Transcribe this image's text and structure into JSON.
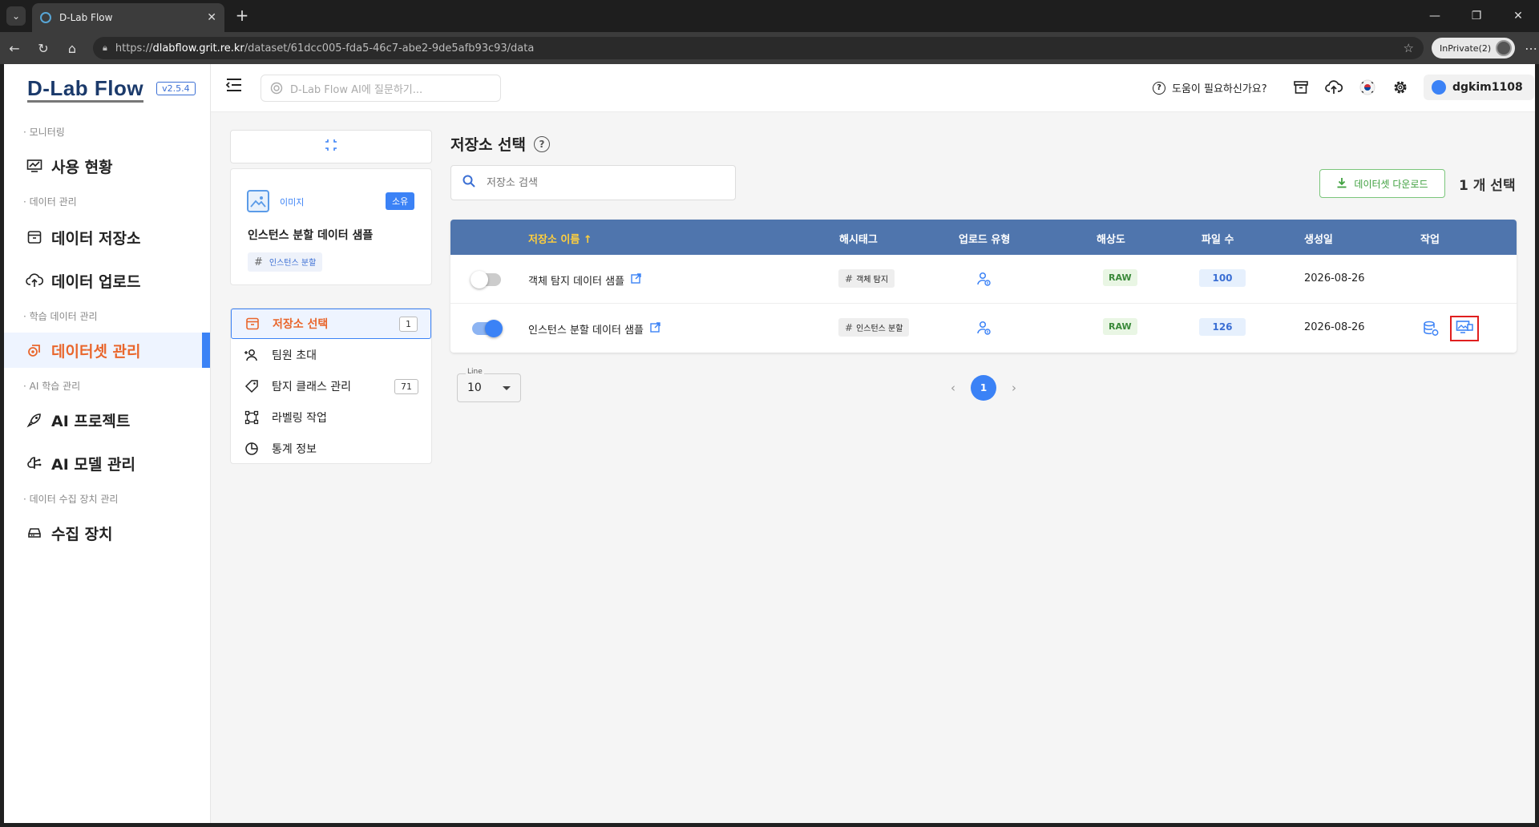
{
  "browser": {
    "tab_title": "D-Lab Flow",
    "url_prefix": "https://",
    "url_host": "dlabflow.grit.re.kr",
    "url_path": "/dataset/61dcc005-fda5-46c7-abe2-9de5afb93c93/data",
    "profile_label": "InPrivate(2)"
  },
  "app": {
    "logo": "D-Lab Flow",
    "version": "v2.5.4"
  },
  "sidebar": {
    "sections": [
      {
        "label": "· 모니터링",
        "items": [
          {
            "label": "사용 현황",
            "icon": "monitor-chart-icon"
          }
        ]
      },
      {
        "label": "· 데이터 관리",
        "items": [
          {
            "label": "데이터 저장소",
            "icon": "archive-icon"
          },
          {
            "label": "데이터 업로드",
            "icon": "cloud-upload-icon"
          }
        ]
      },
      {
        "label": "· 학습 데이터 관리",
        "items": [
          {
            "label": "데이터셋 관리",
            "icon": "dataset-icon",
            "active": true
          }
        ]
      },
      {
        "label": "· AI 학습 관리",
        "items": [
          {
            "label": "AI 프로젝트",
            "icon": "rocket-icon"
          },
          {
            "label": "AI 모델 관리",
            "icon": "brain-icon"
          }
        ]
      },
      {
        "label": "· 데이터 수집 장치 관리",
        "items": [
          {
            "label": "수집 장치",
            "icon": "device-icon"
          }
        ]
      }
    ]
  },
  "topbar": {
    "ai_placeholder": "D-Lab Flow AI에 질문하기...",
    "help_label": "도움이 필요하신가요?",
    "username": "dgkim1108"
  },
  "dataset_card": {
    "type_label": "이미지",
    "owner_badge": "소유",
    "name": "인스턴스 분할 데이터 샘플",
    "tag": "인스턴스 분할"
  },
  "dataset_menu": [
    {
      "label": "저장소 선택",
      "count": "1",
      "active": true,
      "icon": "archive-icon"
    },
    {
      "label": "팀원 초대",
      "count": "",
      "icon": "person-add-icon"
    },
    {
      "label": "탐지 클래스 관리",
      "count": "71",
      "icon": "tag-icon"
    },
    {
      "label": "라벨링 작업",
      "count": "",
      "icon": "bounding-box-icon"
    },
    {
      "label": "통계 정보",
      "count": "",
      "icon": "pie-chart-icon"
    }
  ],
  "main": {
    "title": "저장소 선택",
    "search_placeholder": "저장소 검색",
    "download_label": "데이터셋 다운로드",
    "selected_count": "1 개 선택",
    "columns": [
      "저장소 이름",
      "해시태그",
      "업로드 유형",
      "해상도",
      "파일 수",
      "생성일",
      "작업"
    ],
    "sort_indicator": "↑",
    "rows": [
      {
        "selected": false,
        "name": "객체 탐지 데이터 샘플",
        "hashtag": "객체 탐지",
        "resolution": "RAW",
        "files": "100",
        "created": "2026-08-26"
      },
      {
        "selected": true,
        "name": "인스턴스 분할 데이터 샘플",
        "hashtag": "인스턴스 분할",
        "resolution": "RAW",
        "files": "126",
        "created": "2026-08-26"
      }
    ],
    "line_label": "Line",
    "line_value": "10",
    "current_page": "1"
  },
  "colors": {
    "accent": "#3b82f6",
    "active_text": "#e9662c",
    "table_header": "#4f75ad",
    "sort_header": "#ffcf3d",
    "download_green": "#3fa03f",
    "highlight_red": "#e01f1f"
  }
}
